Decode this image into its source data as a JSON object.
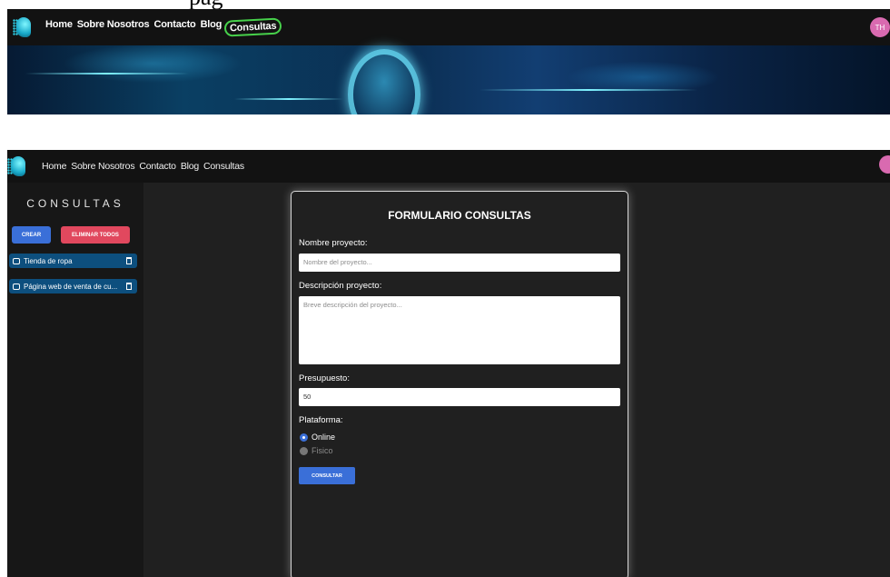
{
  "caption_fragment": "pag",
  "top_nav": {
    "links": [
      "Home",
      "Sobre Nosotros",
      "Contacto",
      "Blog",
      "Consultas"
    ],
    "avatar_initials": "TH"
  },
  "bottom_nav": {
    "links": [
      "Home",
      "Sobre Nosotros",
      "Contacto",
      "Blog",
      "Consultas"
    ]
  },
  "sidebar": {
    "title": "CONSULTAS",
    "create_label": "CREAR",
    "delete_all_label": "ELIMINAR TODOS",
    "items": [
      "Tienda de ropa",
      "Página web de venta de cu..."
    ]
  },
  "form": {
    "title": "FORMULARIO CONSULTAS",
    "name_label": "Nombre proyecto:",
    "name_placeholder": "Nombre del proyecto...",
    "desc_label": "Descripción proyecto:",
    "desc_placeholder": "Breve descripción del proyecto...",
    "budget_label": "Presupuesto:",
    "budget_value": "50",
    "platform_label": "Plataforma:",
    "options": [
      "Online",
      "Fisico"
    ],
    "submit_label": "CONSULTAR"
  },
  "colors": {
    "accent": "#3a6fd8",
    "danger": "#e1485e",
    "highlight": "#47d14b"
  }
}
